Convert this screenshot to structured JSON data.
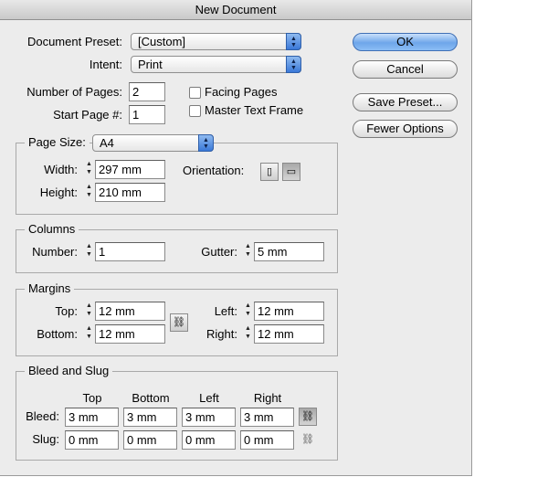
{
  "window": {
    "title": "New Document"
  },
  "preset": {
    "label": "Document Preset:",
    "value": "[Custom]"
  },
  "intent": {
    "label": "Intent:",
    "value": "Print"
  },
  "pages": {
    "number_label": "Number of Pages:",
    "number_value": "2",
    "start_label": "Start Page #:",
    "start_value": "1",
    "facing_label": "Facing Pages",
    "facing_checked": false,
    "master_label": "Master Text Frame",
    "master_checked": false
  },
  "buttons": {
    "ok": "OK",
    "cancel": "Cancel",
    "save_preset": "Save Preset...",
    "fewer_options": "Fewer Options"
  },
  "page_size": {
    "label": "Page Size:",
    "value": "A4",
    "width_label": "Width:",
    "width_value": "297 mm",
    "height_label": "Height:",
    "height_value": "210 mm",
    "orientation_label": "Orientation:",
    "orientation_selected": "landscape"
  },
  "columns": {
    "legend": "Columns",
    "number_label": "Number:",
    "number_value": "1",
    "gutter_label": "Gutter:",
    "gutter_value": "5 mm"
  },
  "margins": {
    "legend": "Margins",
    "top_label": "Top:",
    "top_value": "12 mm",
    "bottom_label": "Bottom:",
    "bottom_value": "12 mm",
    "left_label": "Left:",
    "left_value": "12 mm",
    "right_label": "Right:",
    "right_value": "12 mm"
  },
  "bleed_slug": {
    "legend": "Bleed and Slug",
    "headers": [
      "Top",
      "Bottom",
      "Left",
      "Right"
    ],
    "bleed_label": "Bleed:",
    "bleed_values": [
      "3 mm",
      "3 mm",
      "3 mm",
      "3 mm"
    ],
    "slug_label": "Slug:",
    "slug_values": [
      "0 mm",
      "0 mm",
      "0 mm",
      "0 mm"
    ]
  },
  "icons": {
    "spinner": "stepper-arrows-icon",
    "link": "chain-link-icon",
    "portrait": "portrait-page-icon",
    "landscape": "landscape-page-icon"
  }
}
